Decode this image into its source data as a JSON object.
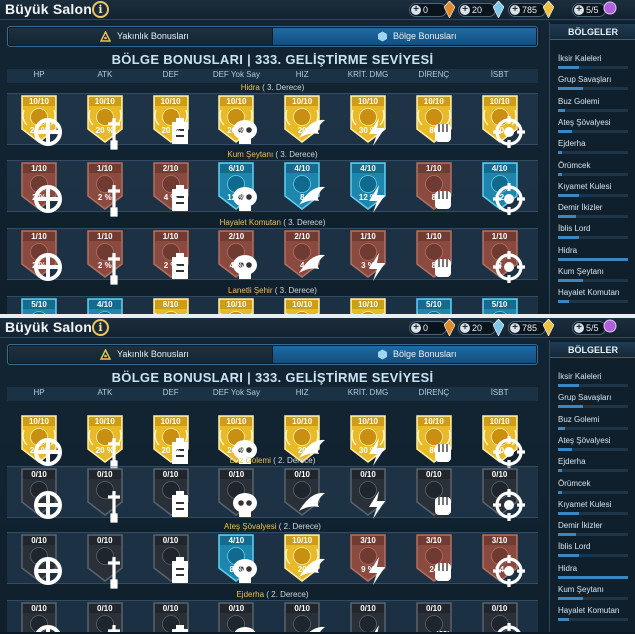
{
  "panels": [
    {
      "title": "Büyük Salon",
      "info_symbol": "i",
      "resources": [
        {
          "value": "0",
          "icon": "amber-crystal-icon"
        },
        {
          "value": "20",
          "icon": "blue-crystal-icon"
        },
        {
          "value": "785",
          "icon": "gold-crystal-icon"
        },
        {
          "value": "5/5",
          "icon": "purple-gem-icon"
        }
      ],
      "tabs": [
        {
          "label": "Yakınlık Bonusları",
          "active": false
        },
        {
          "label": "Bölge Bonusları",
          "active": true
        }
      ],
      "grid_title": "BÖLGE BONUSLARI | 333. GELİŞTİRME SEVİYESİ",
      "headers": [
        "HP",
        "ATK",
        "DEF",
        "DEF Yok Say",
        "HIZ",
        "KRİT. DMG",
        "DİRENÇ",
        "İSBT"
      ],
      "sections": [
        {
          "name": "Hidra",
          "degree": "( 3. Derece)",
          "cells": [
            {
              "level": "10/10",
              "value": "20 %",
              "style": "gold"
            },
            {
              "level": "10/10",
              "value": "20 %",
              "style": "gold"
            },
            {
              "level": "10/10",
              "value": "20 %",
              "style": "gold"
            },
            {
              "level": "10/10",
              "value": "20 %",
              "style": "gold"
            },
            {
              "level": "10/10",
              "value": "20",
              "style": "gold"
            },
            {
              "level": "10/10",
              "value": "30 %",
              "style": "gold"
            },
            {
              "level": "10/10",
              "value": "80",
              "style": "gold"
            },
            {
              "level": "10/10",
              "value": "80",
              "style": "gold"
            }
          ]
        },
        {
          "name": "Kum Şeytanı",
          "degree": "( 3. Derece)",
          "cells": [
            {
              "level": "1/10",
              "value": "2 %",
              "style": "red"
            },
            {
              "level": "1/10",
              "value": "2 %",
              "style": "red"
            },
            {
              "level": "2/10",
              "value": "4 %",
              "style": "red"
            },
            {
              "level": "6/10",
              "value": "12 %",
              "style": "blue"
            },
            {
              "level": "4/10",
              "value": "8",
              "style": "blue"
            },
            {
              "level": "4/10",
              "value": "12 %",
              "style": "blue"
            },
            {
              "level": "1/10",
              "value": "8",
              "style": "red"
            },
            {
              "level": "4/10",
              "value": "32",
              "style": "blue"
            }
          ]
        },
        {
          "name": "Hayalet Komutan",
          "degree": "( 3. Derece)",
          "cells": [
            {
              "level": "1/10",
              "value": "2 %",
              "style": "red"
            },
            {
              "level": "1/10",
              "value": "2 %",
              "style": "red"
            },
            {
              "level": "1/10",
              "value": "2 %",
              "style": "red"
            },
            {
              "level": "2/10",
              "value": "4 %",
              "style": "red"
            },
            {
              "level": "2/10",
              "value": "4",
              "style": "red"
            },
            {
              "level": "1/10",
              "value": "3 %",
              "style": "red"
            },
            {
              "level": "1/10",
              "value": "8",
              "style": "red"
            },
            {
              "level": "1/10",
              "value": "8",
              "style": "red"
            }
          ]
        },
        {
          "name": "Lanetli Şehir",
          "degree": "( 3. Derece)",
          "cells": [
            {
              "level": "5/10",
              "value": "",
              "style": "blue"
            },
            {
              "level": "4/10",
              "value": "",
              "style": "blue"
            },
            {
              "level": "8/10",
              "value": "",
              "style": "gold"
            },
            {
              "level": "10/10",
              "value": "",
              "style": "gold"
            },
            {
              "level": "10/10",
              "value": "",
              "style": "gold"
            },
            {
              "level": "10/10",
              "value": "",
              "style": "gold"
            },
            {
              "level": "5/10",
              "value": "",
              "style": "blue"
            },
            {
              "level": "5/10",
              "value": "",
              "style": "blue"
            }
          ]
        }
      ],
      "side_title": "BÖLGELER",
      "side_items": [
        {
          "label": "İksir Kaleleri",
          "progress": 0.3
        },
        {
          "label": "Grup Savaşları",
          "progress": 0.35
        },
        {
          "label": "Buz Golemi",
          "progress": 0.1
        },
        {
          "label": "Ateş Şövalyesi",
          "progress": 0.2
        },
        {
          "label": "Ejderha",
          "progress": 0.05
        },
        {
          "label": "Örümcek",
          "progress": 0.05
        },
        {
          "label": "Kıyamet Kulesi",
          "progress": 0.3
        },
        {
          "label": "Demir İkizler",
          "progress": 0.25
        },
        {
          "label": "İblis Lord",
          "progress": 0.3
        },
        {
          "label": "Hidra",
          "progress": 1.0
        },
        {
          "label": "Kum Şeytanı",
          "progress": 0.35
        },
        {
          "label": "Hayalet Komutan",
          "progress": 0.15
        }
      ]
    },
    {
      "title": "Büyük Salon",
      "info_symbol": "i",
      "resources": [
        {
          "value": "0",
          "icon": "amber-crystal-icon"
        },
        {
          "value": "20",
          "icon": "blue-crystal-icon"
        },
        {
          "value": "785",
          "icon": "gold-crystal-icon"
        },
        {
          "value": "5/5",
          "icon": "purple-gem-icon"
        }
      ],
      "tabs": [
        {
          "label": "Yakınlık Bonusları",
          "active": false
        },
        {
          "label": "Bölge Bonusları",
          "active": true
        }
      ],
      "grid_title": "BÖLGE BONUSLARI | 333. GELİŞTİRME SEVİYESİ",
      "headers": [
        "HP",
        "ATK",
        "DEF",
        "DEF Yok Say",
        "HIZ",
        "KRİT. DMG",
        "DİRENÇ",
        "İSBT"
      ],
      "sections": [
        {
          "name": "",
          "degree": "",
          "cells": [
            {
              "level": "10/10",
              "value": "20 %",
              "style": "gold"
            },
            {
              "level": "10/10",
              "value": "20 %",
              "style": "gold"
            },
            {
              "level": "10/10",
              "value": "20 %",
              "style": "gold"
            },
            {
              "level": "10/10",
              "value": "20 %",
              "style": "gold"
            },
            {
              "level": "10/10",
              "value": "20",
              "style": "gold"
            },
            {
              "level": "10/10",
              "value": "30 %",
              "style": "gold"
            },
            {
              "level": "10/10",
              "value": "80",
              "style": "gold"
            },
            {
              "level": "10/10",
              "value": "80",
              "style": "gold"
            }
          ]
        },
        {
          "name": "Buz Golemi",
          "degree": "( 2. Derece)",
          "cells": [
            {
              "level": "0/10",
              "value": "",
              "style": "gray"
            },
            {
              "level": "0/10",
              "value": "",
              "style": "gray"
            },
            {
              "level": "0/10",
              "value": "",
              "style": "gray"
            },
            {
              "level": "0/10",
              "value": "",
              "style": "gray"
            },
            {
              "level": "0/10",
              "value": "",
              "style": "gray"
            },
            {
              "level": "0/10",
              "value": "",
              "style": "gray"
            },
            {
              "level": "0/10",
              "value": "",
              "style": "gray"
            },
            {
              "level": "0/10",
              "value": "",
              "style": "gray"
            }
          ]
        },
        {
          "name": "Ateş Şövalyesi",
          "degree": "( 2. Derece)",
          "cells": [
            {
              "level": "0/10",
              "value": "",
              "style": "gray"
            },
            {
              "level": "0/10",
              "value": "",
              "style": "gray"
            },
            {
              "level": "0/10",
              "value": "",
              "style": "gray"
            },
            {
              "level": "4/10",
              "value": "8 %",
              "style": "blue"
            },
            {
              "level": "10/10",
              "value": "20",
              "style": "gold"
            },
            {
              "level": "3/10",
              "value": "9 %",
              "style": "red"
            },
            {
              "level": "3/10",
              "value": "24",
              "style": "red"
            },
            {
              "level": "3/10",
              "value": "24",
              "style": "red"
            }
          ]
        },
        {
          "name": "Ejderha",
          "degree": "( 2. Derece)",
          "cells": [
            {
              "level": "0/10",
              "value": "",
              "style": "gray"
            },
            {
              "level": "0/10",
              "value": "",
              "style": "gray"
            },
            {
              "level": "0/10",
              "value": "",
              "style": "gray"
            },
            {
              "level": "0/10",
              "value": "",
              "style": "gray"
            },
            {
              "level": "0/10",
              "value": "",
              "style": "gray"
            },
            {
              "level": "0/10",
              "value": "",
              "style": "gray"
            },
            {
              "level": "0/10",
              "value": "",
              "style": "gray"
            },
            {
              "level": "0/10",
              "value": "",
              "style": "gray"
            }
          ]
        }
      ],
      "side_title": "BÖLGELER",
      "side_items": [
        {
          "label": "İksir Kaleleri",
          "progress": 0.3
        },
        {
          "label": "Grup Savaşları",
          "progress": 0.35
        },
        {
          "label": "Buz Golemi",
          "progress": 0.1
        },
        {
          "label": "Ateş Şövalyesi",
          "progress": 0.2
        },
        {
          "label": "Ejderha",
          "progress": 0.05
        },
        {
          "label": "Örümcek",
          "progress": 0.05
        },
        {
          "label": "Kıyamet Kulesi",
          "progress": 0.3
        },
        {
          "label": "Demir İkizler",
          "progress": 0.25
        },
        {
          "label": "İblis Lord",
          "progress": 0.3
        },
        {
          "label": "Hidra",
          "progress": 1.0
        },
        {
          "label": "Kum Şeytanı",
          "progress": 0.35
        },
        {
          "label": "Hayalet Komutan",
          "progress": 0.15
        }
      ]
    }
  ],
  "colors": {
    "gold_fill": "#e8b928",
    "gold_edge": "#fff0a8",
    "red_fill": "#8a4a3f",
    "blue_fill": "#1e86ad",
    "gray_fill": "#2a3038",
    "active_tab": "#1f6aa3",
    "section_title": "#e8c25a"
  },
  "stat_icons": [
    "shield-cross-icon",
    "sword-icon",
    "tower-icon",
    "skull-icon",
    "wing-icon",
    "lightning-icon",
    "fist-icon",
    "target-icon"
  ]
}
